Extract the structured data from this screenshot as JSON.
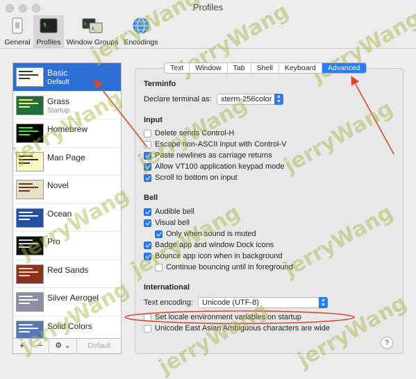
{
  "window": {
    "title": "Profiles"
  },
  "toolbar": [
    {
      "label": "General",
      "icon": "switch-icon"
    },
    {
      "label": "Profiles",
      "icon": "terminal-icon"
    },
    {
      "label": "Window Groups",
      "icon": "window-groups-icon"
    },
    {
      "label": "Encodings",
      "icon": "globe-icon"
    }
  ],
  "profiles": [
    {
      "name": "Basic",
      "sub": "Default"
    },
    {
      "name": "Grass",
      "sub": "Startup"
    },
    {
      "name": "Homebrew",
      "sub": ""
    },
    {
      "name": "Man Page",
      "sub": ""
    },
    {
      "name": "Novel",
      "sub": ""
    },
    {
      "name": "Ocean",
      "sub": ""
    },
    {
      "name": "Pro",
      "sub": ""
    },
    {
      "name": "Red Sands",
      "sub": ""
    },
    {
      "name": "Silver Aerogel",
      "sub": ""
    },
    {
      "name": "Solid Colors",
      "sub": ""
    }
  ],
  "sidebar_footer": {
    "add": "+",
    "remove": "−",
    "gear": "⚙︎ ⌄",
    "default": "Default"
  },
  "tabs": [
    "Text",
    "Window",
    "Tab",
    "Shell",
    "Keyboard",
    "Advanced"
  ],
  "terminfo": {
    "heading": "Terminfo",
    "declare_label": "Declare terminal as:",
    "declare_value": "xterm-256color"
  },
  "input": {
    "heading": "Input",
    "options": [
      {
        "label": "Delete sends Control-H",
        "checked": false
      },
      {
        "label": "Escape non-ASCII input with Control-V",
        "checked": false
      },
      {
        "label": "Paste newlines as carriage returns",
        "checked": true
      },
      {
        "label": "Allow VT100 application keypad mode",
        "checked": true
      },
      {
        "label": "Scroll to bottom on input",
        "checked": true
      }
    ]
  },
  "bell": {
    "heading": "Bell",
    "options": [
      {
        "label": "Audible bell",
        "checked": true
      },
      {
        "label": "Visual bell",
        "checked": true
      },
      {
        "label": "Only when sound is muted",
        "checked": true
      },
      {
        "label": "Badge app and window Dock icons",
        "checked": true
      },
      {
        "label": "Bounce app icon when in background",
        "checked": true
      },
      {
        "label": "Continue bouncing until in foreground",
        "checked": false
      }
    ]
  },
  "international": {
    "heading": "International",
    "encoding_label": "Text encoding:",
    "encoding_value": "Unicode (UTF-8)",
    "options": [
      {
        "label": "Set locale environment variables on startup",
        "checked": false
      },
      {
        "label": "Unicode East Asian Ambiguous characters are wide",
        "checked": false
      }
    ]
  },
  "help": "?",
  "watermark": "jerryWang",
  "colors": {
    "accent": "#2d7cf6",
    "selection": "#2b6fd6",
    "annotation": "#e0442c"
  }
}
